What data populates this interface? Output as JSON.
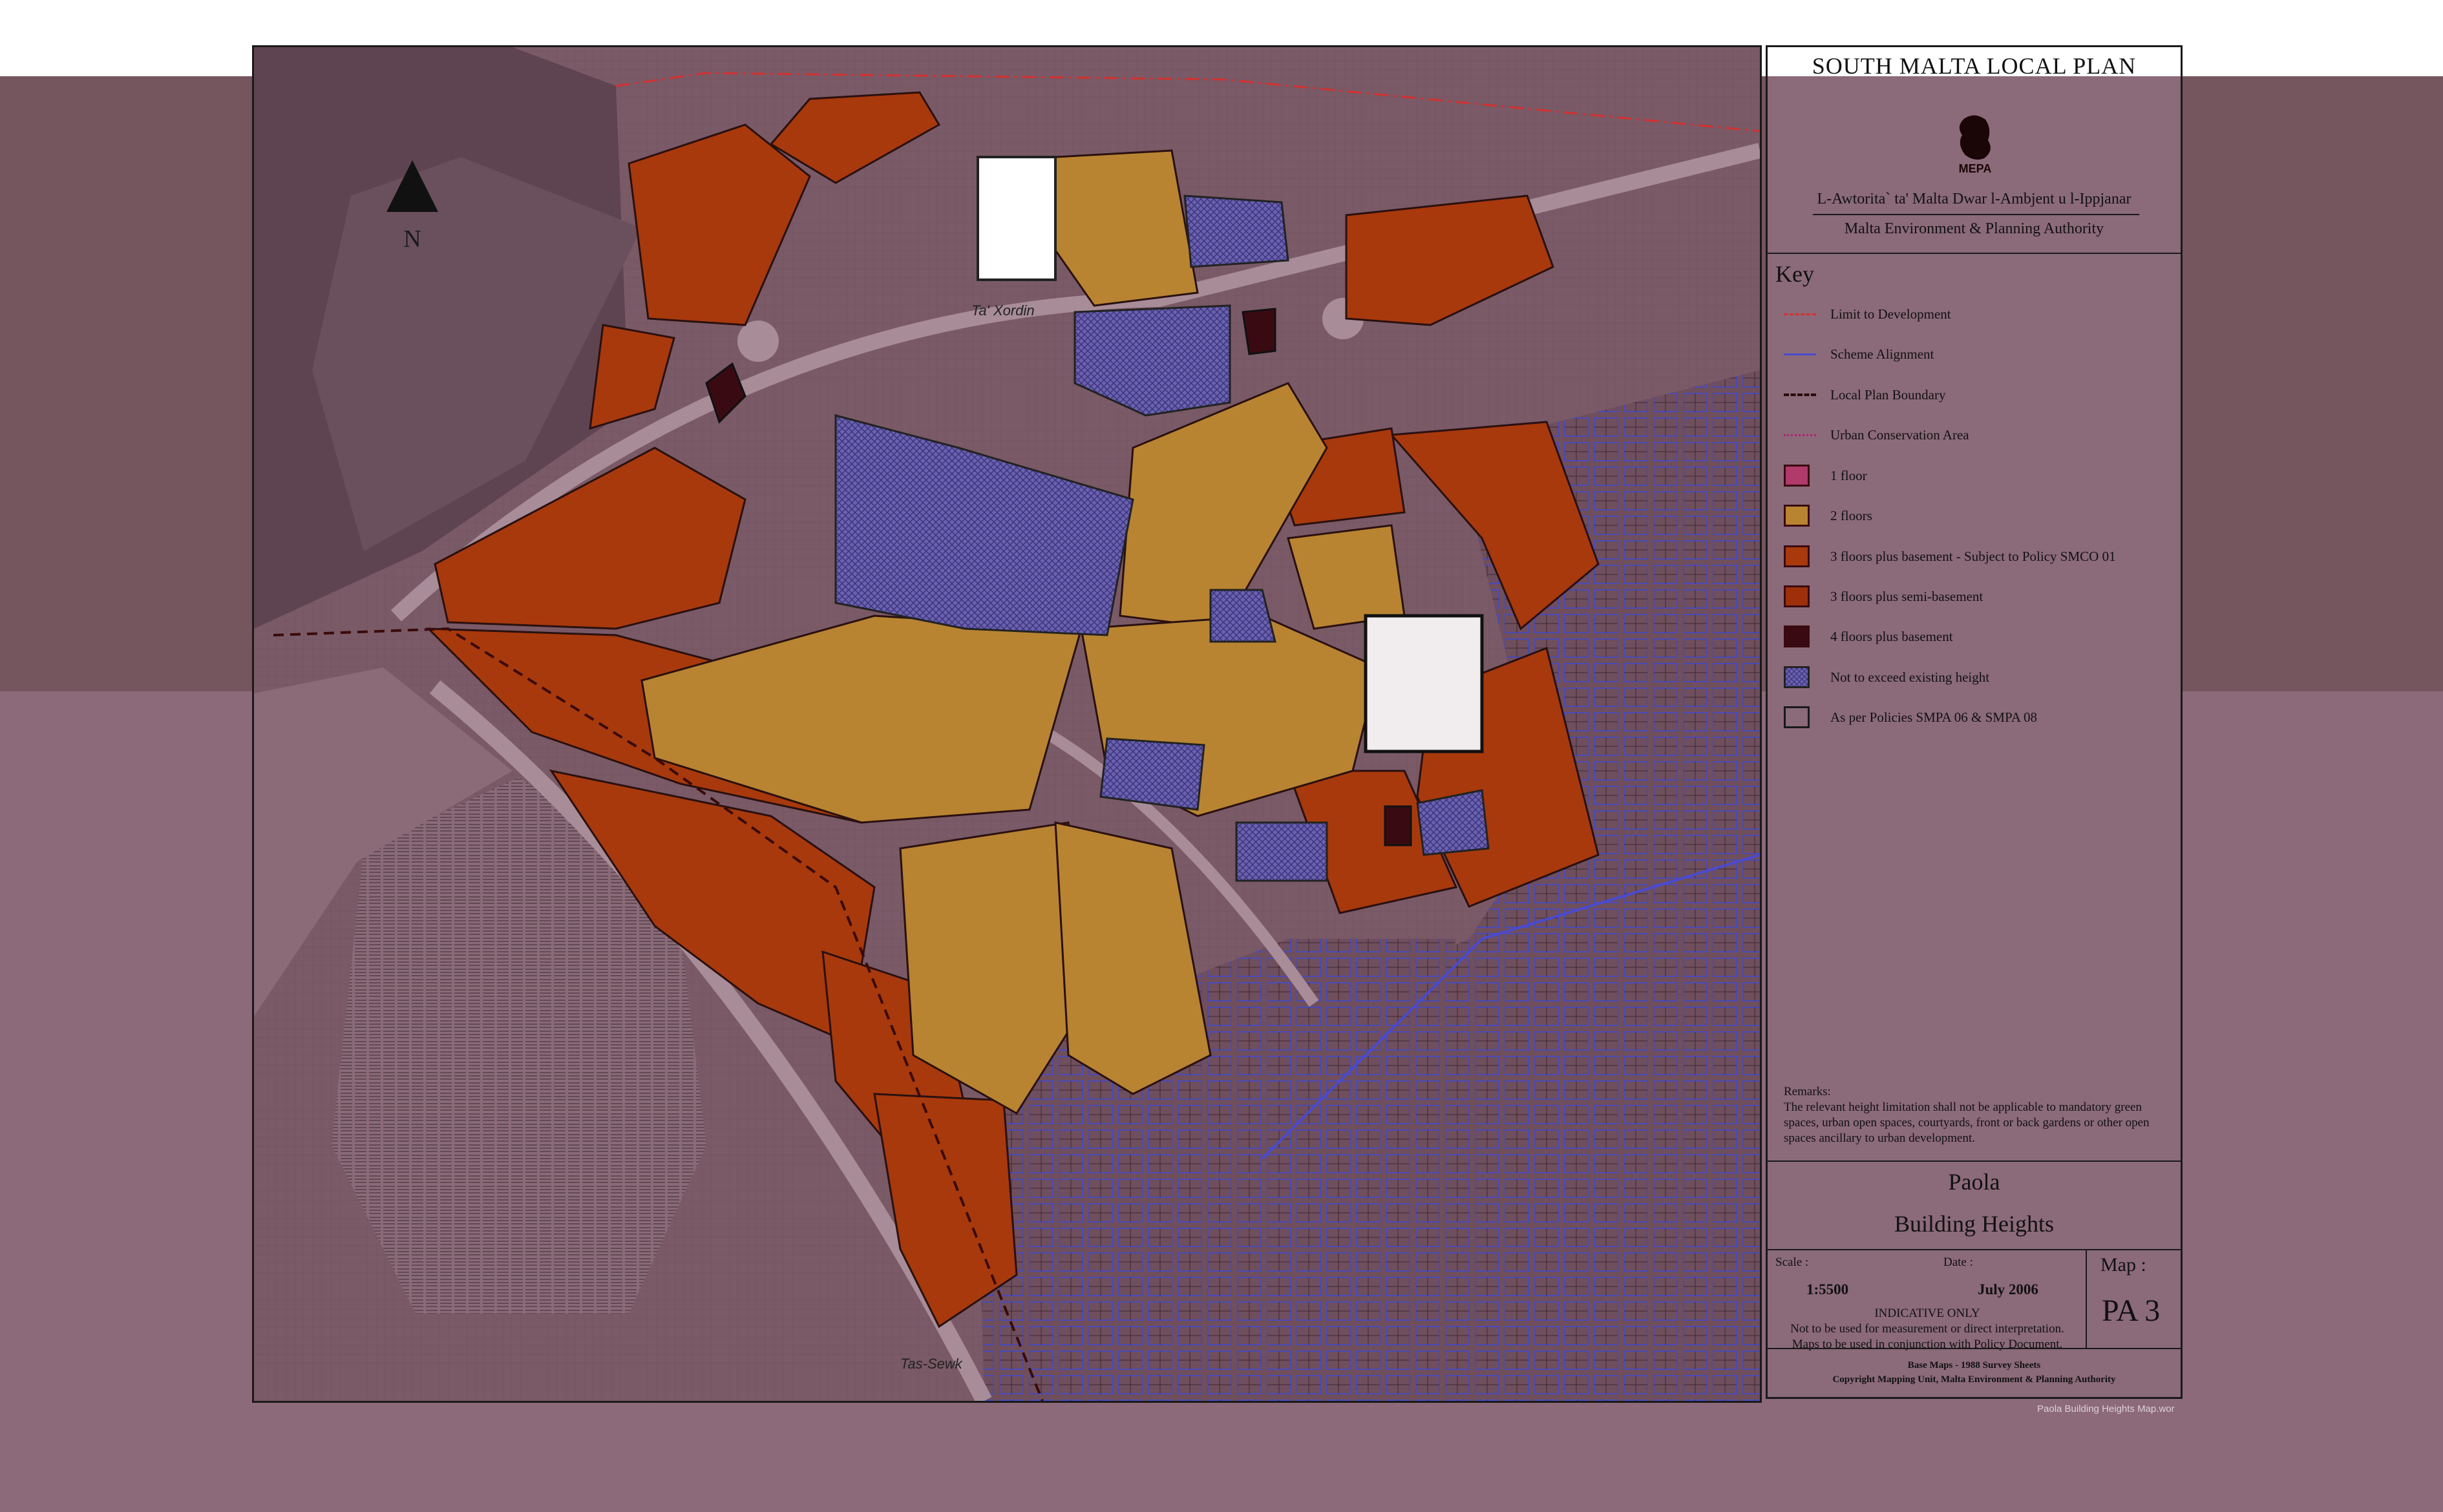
{
  "map": {
    "north_letter": "N",
    "place_labels": [
      "Ta' Xordin",
      "Tas-Sewk"
    ]
  },
  "panel": {
    "plan_title": "SOUTH MALTA LOCAL PLAN",
    "logo_text": "MEPA",
    "authority_mt": "L-Awtorita` ta' Malta Dwar l-Ambjent u l-Ippjanar",
    "authority_en": "Malta Environment & Planning Authority",
    "key_heading": "Key",
    "legend": [
      {
        "label": "Limit to Development",
        "kind": "line",
        "color": "#d43030",
        "style": "dashdot"
      },
      {
        "label": "Scheme Alignment",
        "kind": "line",
        "color": "#4a4ad0",
        "style": "solid"
      },
      {
        "label": "Local Plan Boundary",
        "kind": "line",
        "color": "#2a0a0a",
        "style": "dashed"
      },
      {
        "label": "Urban Conservation Area",
        "kind": "line",
        "color": "#b02070",
        "style": "dotted"
      },
      {
        "label": "1 floor",
        "kind": "swatch",
        "color": "#b03a6a"
      },
      {
        "label": "2 floors",
        "kind": "swatch",
        "color": "#b88432"
      },
      {
        "label": "3 floors plus basement - Subject to Policy SMCO 01",
        "kind": "swatch",
        "color": "#a8390c"
      },
      {
        "label": "3 floors plus semi-basement",
        "kind": "swatch",
        "color": "#9e2f0b"
      },
      {
        "label": "4 floors plus basement",
        "kind": "swatch",
        "color": "#3a0a12"
      },
      {
        "label": "Not to exceed existing height",
        "kind": "hatch",
        "color": "#6a62b0"
      },
      {
        "label": "As per Policies SMPA 06 & SMPA 08",
        "kind": "outline",
        "color": "#1a1a1a"
      }
    ],
    "remarks_heading": "Remarks:",
    "remarks_text": "The relevant height limitation shall not be applicable to mandatory green spaces, urban open spaces, courtyards, front or back gardens or other open spaces ancillary to urban development.",
    "locality": "Paola",
    "map_title": "Building Heights",
    "scale_label": "Scale :",
    "scale_value": "1:5500",
    "date_label": "Date :",
    "date_value": "July 2006",
    "map_label": "Map :",
    "map_number": "PA 3",
    "indicative": "INDICATIVE ONLY",
    "disclaimer_1": "Not to be used for measurement or direct interpretation.",
    "disclaimer_2": "Maps to be used in conjunction with Policy Document.",
    "base_maps": "Base Maps - 1988 Survey Sheets",
    "copyright": "Copyright Mapping Unit, Malta Environment & Planning Authority"
  },
  "file_name": "Paola Building Heights Map.wor"
}
